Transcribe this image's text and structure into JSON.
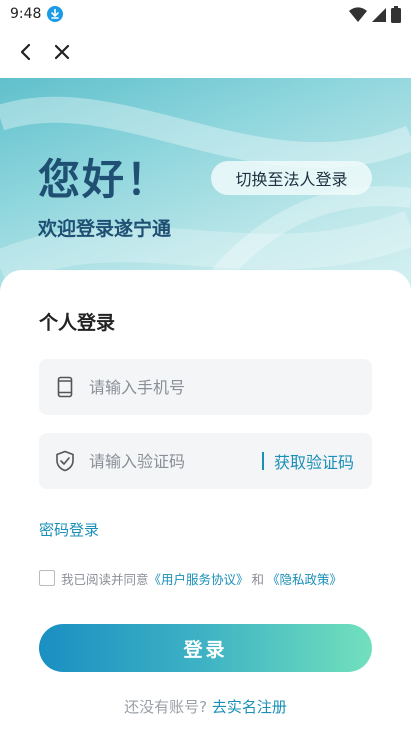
{
  "status": {
    "time": "9:48"
  },
  "hero": {
    "hello": "您好！",
    "welcome": "欢迎登录遂宁通",
    "switch_label": "切换至法人登录"
  },
  "form": {
    "title": "个人登录",
    "phone_placeholder": "请输入手机号",
    "code_placeholder": "请输入验证码",
    "get_code_label": "获取验证码",
    "password_login": "密码登录",
    "agree_prefix": "我已阅读并同意",
    "user_agreement": "《用户服务协议》",
    "agree_and": "和",
    "privacy_policy": "《隐私政策》",
    "login_label": "登录",
    "no_account": "还没有账号?",
    "register_link": "去实名注册"
  },
  "colors": {
    "accent": "#1a8fb7",
    "hero_text": "#1f4f72"
  }
}
